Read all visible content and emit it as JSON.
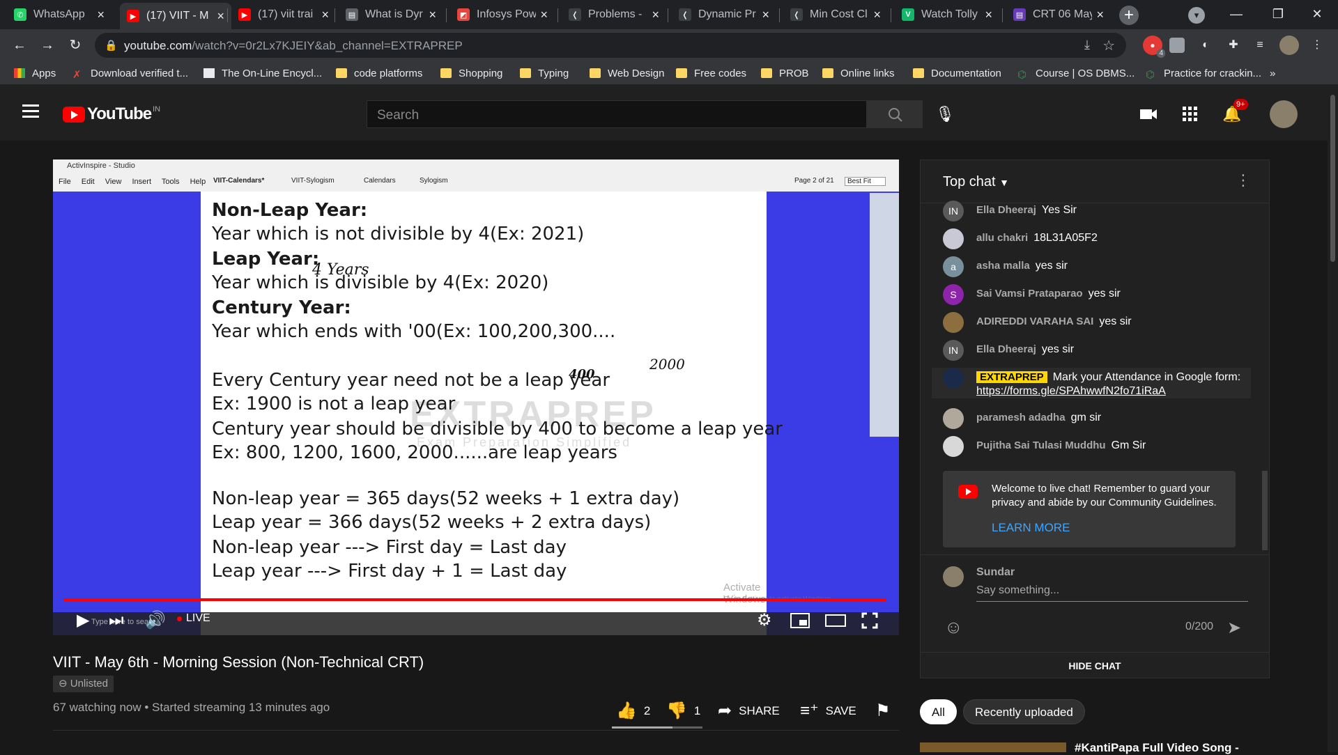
{
  "browser": {
    "tabs": [
      {
        "title": "WhatsApp",
        "color": "#25d366",
        "glyph": "✆"
      },
      {
        "title": "(17) VIIT - M",
        "color": "#ff0000",
        "glyph": "▶"
      },
      {
        "title": "(17) viit trai",
        "color": "#ff0000",
        "glyph": "▶"
      },
      {
        "title": "What is Dyr",
        "color": "#5f6368",
        "glyph": "▤"
      },
      {
        "title": "Infosys Pow",
        "color": "#e8453c",
        "glyph": "◩"
      },
      {
        "title": "Problems -",
        "color": "#3c4043",
        "glyph": "❬"
      },
      {
        "title": "Dynamic Pr",
        "color": "#3c4043",
        "glyph": "❬"
      },
      {
        "title": "Min Cost Cl",
        "color": "#3c4043",
        "glyph": "❬"
      },
      {
        "title": "Watch Tolly",
        "color": "#12b76a",
        "glyph": "V"
      },
      {
        "title": "CRT 06 May",
        "color": "#673ab7",
        "glyph": "▤"
      }
    ],
    "url_main": "youtube.com",
    "url_rest": "/watch?v=0r2Lx7KJEIY&ab_channel=EXTRAPREP",
    "ext_badge": "4",
    "bookmarks": [
      {
        "label": "Apps",
        "type": "apps"
      },
      {
        "label": "Download verified t...",
        "type": "x"
      },
      {
        "label": "The On-Line Encycl...",
        "type": "oeis"
      },
      {
        "label": "code platforms",
        "type": "folder"
      },
      {
        "label": "Shopping",
        "type": "folder"
      },
      {
        "label": "Typing",
        "type": "folder"
      },
      {
        "label": "Web Design",
        "type": "folder"
      },
      {
        "label": "Free codes",
        "type": "folder"
      },
      {
        "label": "PROB",
        "type": "folder"
      },
      {
        "label": "Online links",
        "type": "folder"
      },
      {
        "label": "Documentation",
        "type": "folder"
      },
      {
        "label": "Course | OS DBMS...",
        "type": "gfg"
      },
      {
        "label": "Practice for crackin...",
        "type": "gfg"
      }
    ]
  },
  "youtube": {
    "logo_text": "YouTube",
    "country": "IN",
    "search_placeholder": "Search",
    "notif_badge": "9+"
  },
  "video": {
    "title": "VIIT - May 6th - Morning Session (Non-Technical CRT)",
    "unlisted": "Unlisted",
    "meta": "67 watching now • Started streaming 13 minutes ago",
    "likes": "2",
    "dislikes": "1",
    "share": "SHARE",
    "save": "SAVE",
    "live": "LIVE",
    "like_ratio": 0.67,
    "progress": 1.0
  },
  "slide": {
    "app_title": "ActivInspire - Studio",
    "menu": "File Edit View Insert Tools Help",
    "doc_tabs": [
      "VIIT-Calendars*",
      "VIIT-Sylogism",
      "Calendars",
      "Sylogism"
    ],
    "page": "Page 2 of 21",
    "fit": "Best Fit",
    "lines": [
      {
        "text": "Non-Leap Year:",
        "bold": true
      },
      {
        "text": "Year which is not divisible by 4(Ex: 2021)",
        "bold": false
      },
      {
        "text": "Leap Year:",
        "bold": true
      },
      {
        "text": "Year which is divisible by 4(Ex: 2020)",
        "bold": false
      },
      {
        "text": "Century Year:",
        "bold": true
      },
      {
        "text": "Year which ends with '00(Ex: 100,200,300....",
        "bold": false
      },
      {
        "text": "Every Century year need not be a leap year",
        "bold": false
      },
      {
        "text": "Ex: 1900 is not a leap year",
        "bold": false
      },
      {
        "text": "Century year should be divisible by 400 to become a leap year",
        "bold": false
      },
      {
        "text": "Ex: 800, 1200, 1600, 2000......are leap years",
        "bold": false
      },
      {
        "text": "Non-leap year = 365 days(52 weeks + 1 extra day)",
        "bold": false
      },
      {
        "text": "Leap year = 366 days(52 weeks + 2 extra days)",
        "bold": false
      },
      {
        "text": "Non-leap year ---> First day = Last day",
        "bold": false
      },
      {
        "text": "Leap year ---> First day + 1 = Last day",
        "bold": false
      }
    ],
    "handwritten": [
      "4 Years",
      "400",
      "2000"
    ],
    "watermark_main": "EXTRAPREP",
    "watermark_sub": "Exam Preparation Simplified",
    "activate_1": "Activate Windows",
    "activate_2": "Go to Settings to activate Windows.",
    "taskbar_search": "Type here to search"
  },
  "chat": {
    "header": "Top chat",
    "messages": [
      {
        "author": "Ella Dheeraj",
        "text": "Yes Sir",
        "avatar_color": "#5a5a5a",
        "avatar_letter": "IN"
      },
      {
        "author": "allu chakri",
        "text": "18L31A05F2",
        "avatar_color": "#c9c9d6",
        "avatar_letter": ""
      },
      {
        "author": "asha malla",
        "text": "yes sir",
        "avatar_color": "#78909c",
        "avatar_letter": "a"
      },
      {
        "author": "Sai Vamsi Prataparao",
        "text": "yes sir",
        "avatar_color": "#8e24aa",
        "avatar_letter": "S"
      },
      {
        "author": "ADIREDDI VARAHA SAI",
        "text": "yes sir",
        "avatar_color": "#8d6e3f",
        "avatar_letter": ""
      },
      {
        "author": "Ella Dheeraj",
        "text": "yes sir",
        "avatar_color": "#5a5a5a",
        "avatar_letter": "IN"
      },
      {
        "author": "EXTRAPREP",
        "text": "Mark your Attendance in Google form: ",
        "link": "https://forms.gle/SPAhwwfN2fo71iRaA",
        "avatar_color": "#1c2a4a",
        "avatar_letter": "",
        "owner": true
      },
      {
        "author": "paramesh adadha",
        "text": "gm sir",
        "avatar_color": "#b0a89a",
        "avatar_letter": ""
      },
      {
        "author": "Pujitha Sai Tulasi Muddhu",
        "text": "Gm Sir",
        "avatar_color": "#d8d8d8",
        "avatar_letter": ""
      }
    ],
    "welcome": "Welcome to live chat! Remember to guard your privacy and abide by our Community Guidelines.",
    "learn_more": "LEARN MORE",
    "user_name": "Sundar",
    "input_placeholder": "Say something...",
    "counter": "0/200",
    "hide_chat": "HIDE CHAT"
  },
  "chips": [
    "All",
    "Recently uploaded"
  ],
  "recommendation_title": "#KantiPapa Full Video Song -"
}
